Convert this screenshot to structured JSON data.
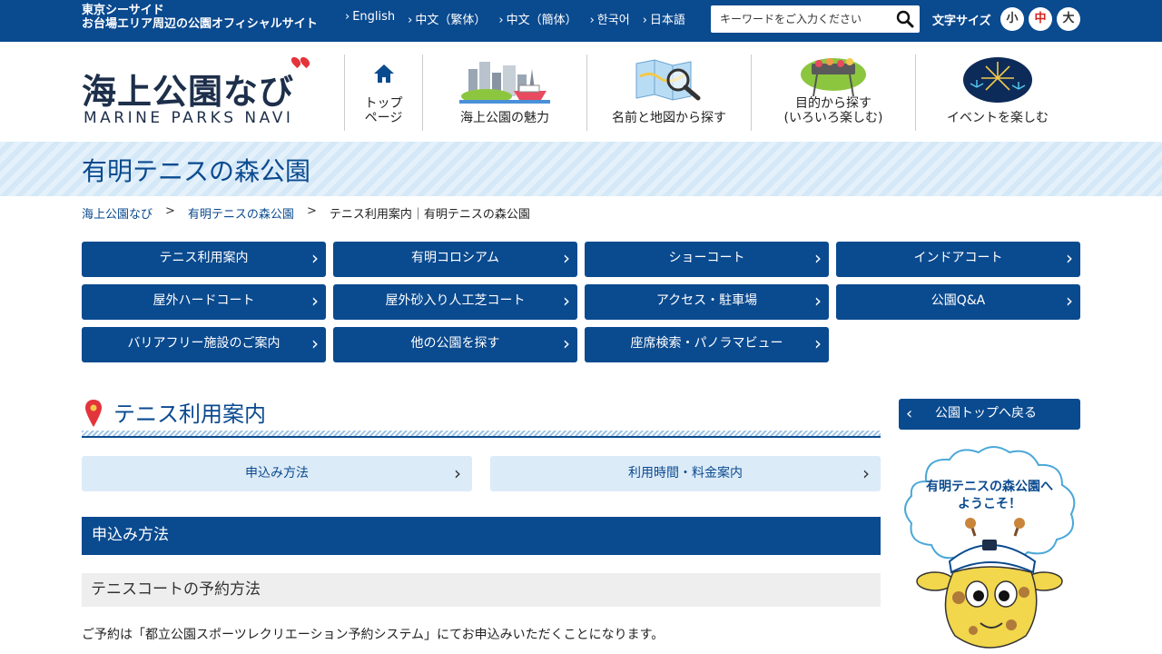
{
  "topbar": {
    "site_line1": "東京シーサイド",
    "site_line2": "お台場エリア周辺の公園オフィシャルサイト",
    "languages": [
      "English",
      "中文（繁体）",
      "中文（簡体）",
      "한국어",
      "日本語"
    ],
    "search_placeholder": "キーワードをご入力ください",
    "font_size_label": "文字サイズ",
    "font_sizes": [
      "小",
      "中",
      "大"
    ]
  },
  "logo": {
    "jp": "海上公園なび",
    "en": "MARINE PARKS NAVI"
  },
  "gnav": [
    {
      "label1": "トップ",
      "label2": "ページ"
    },
    {
      "label1": "海上公園の魅力",
      "label2": ""
    },
    {
      "label1": "名前と地図から探す",
      "label2": ""
    },
    {
      "label1": "目的から探す",
      "label2": "(いろいろ楽しむ)"
    },
    {
      "label1": "イベントを楽しむ",
      "label2": ""
    }
  ],
  "page_title": "有明テニスの森公園",
  "breadcrumb": {
    "home": "海上公園なび",
    "park": "有明テニスの森公園",
    "current": "テニス利用案内｜有明テニスの森公園",
    "separator": ">"
  },
  "menu": [
    "テニス利用案内",
    "有明コロシアム",
    "ショーコート",
    "インドアコート",
    "屋外ハードコート",
    "屋外砂入り人工芝コート",
    "アクセス・駐車場",
    "公園Q&A",
    "バリアフリー施設のご案内",
    "他の公園を探す",
    "座席検索・パノラマビュー"
  ],
  "section_title": "テニス利用案内",
  "sub_links": [
    "申込み方法",
    "利用時間・料金案内"
  ],
  "h3": "申込み方法",
  "h4": "テニスコートの予約方法",
  "body_text": "ご予約は「都立公園スポーツレクリエーション予約システム」にてお申込みいただくことになります。",
  "sidebar": {
    "back_label": "公園トップへ戻る",
    "back_arrow": "‹",
    "bubble_line1": "有明テニスの森公園へ",
    "bubble_line2": "ようこそ！"
  },
  "colors": {
    "primary": "#0a4a8f",
    "light_blue": "#dcebf8",
    "accent_red": "#d9201e"
  }
}
